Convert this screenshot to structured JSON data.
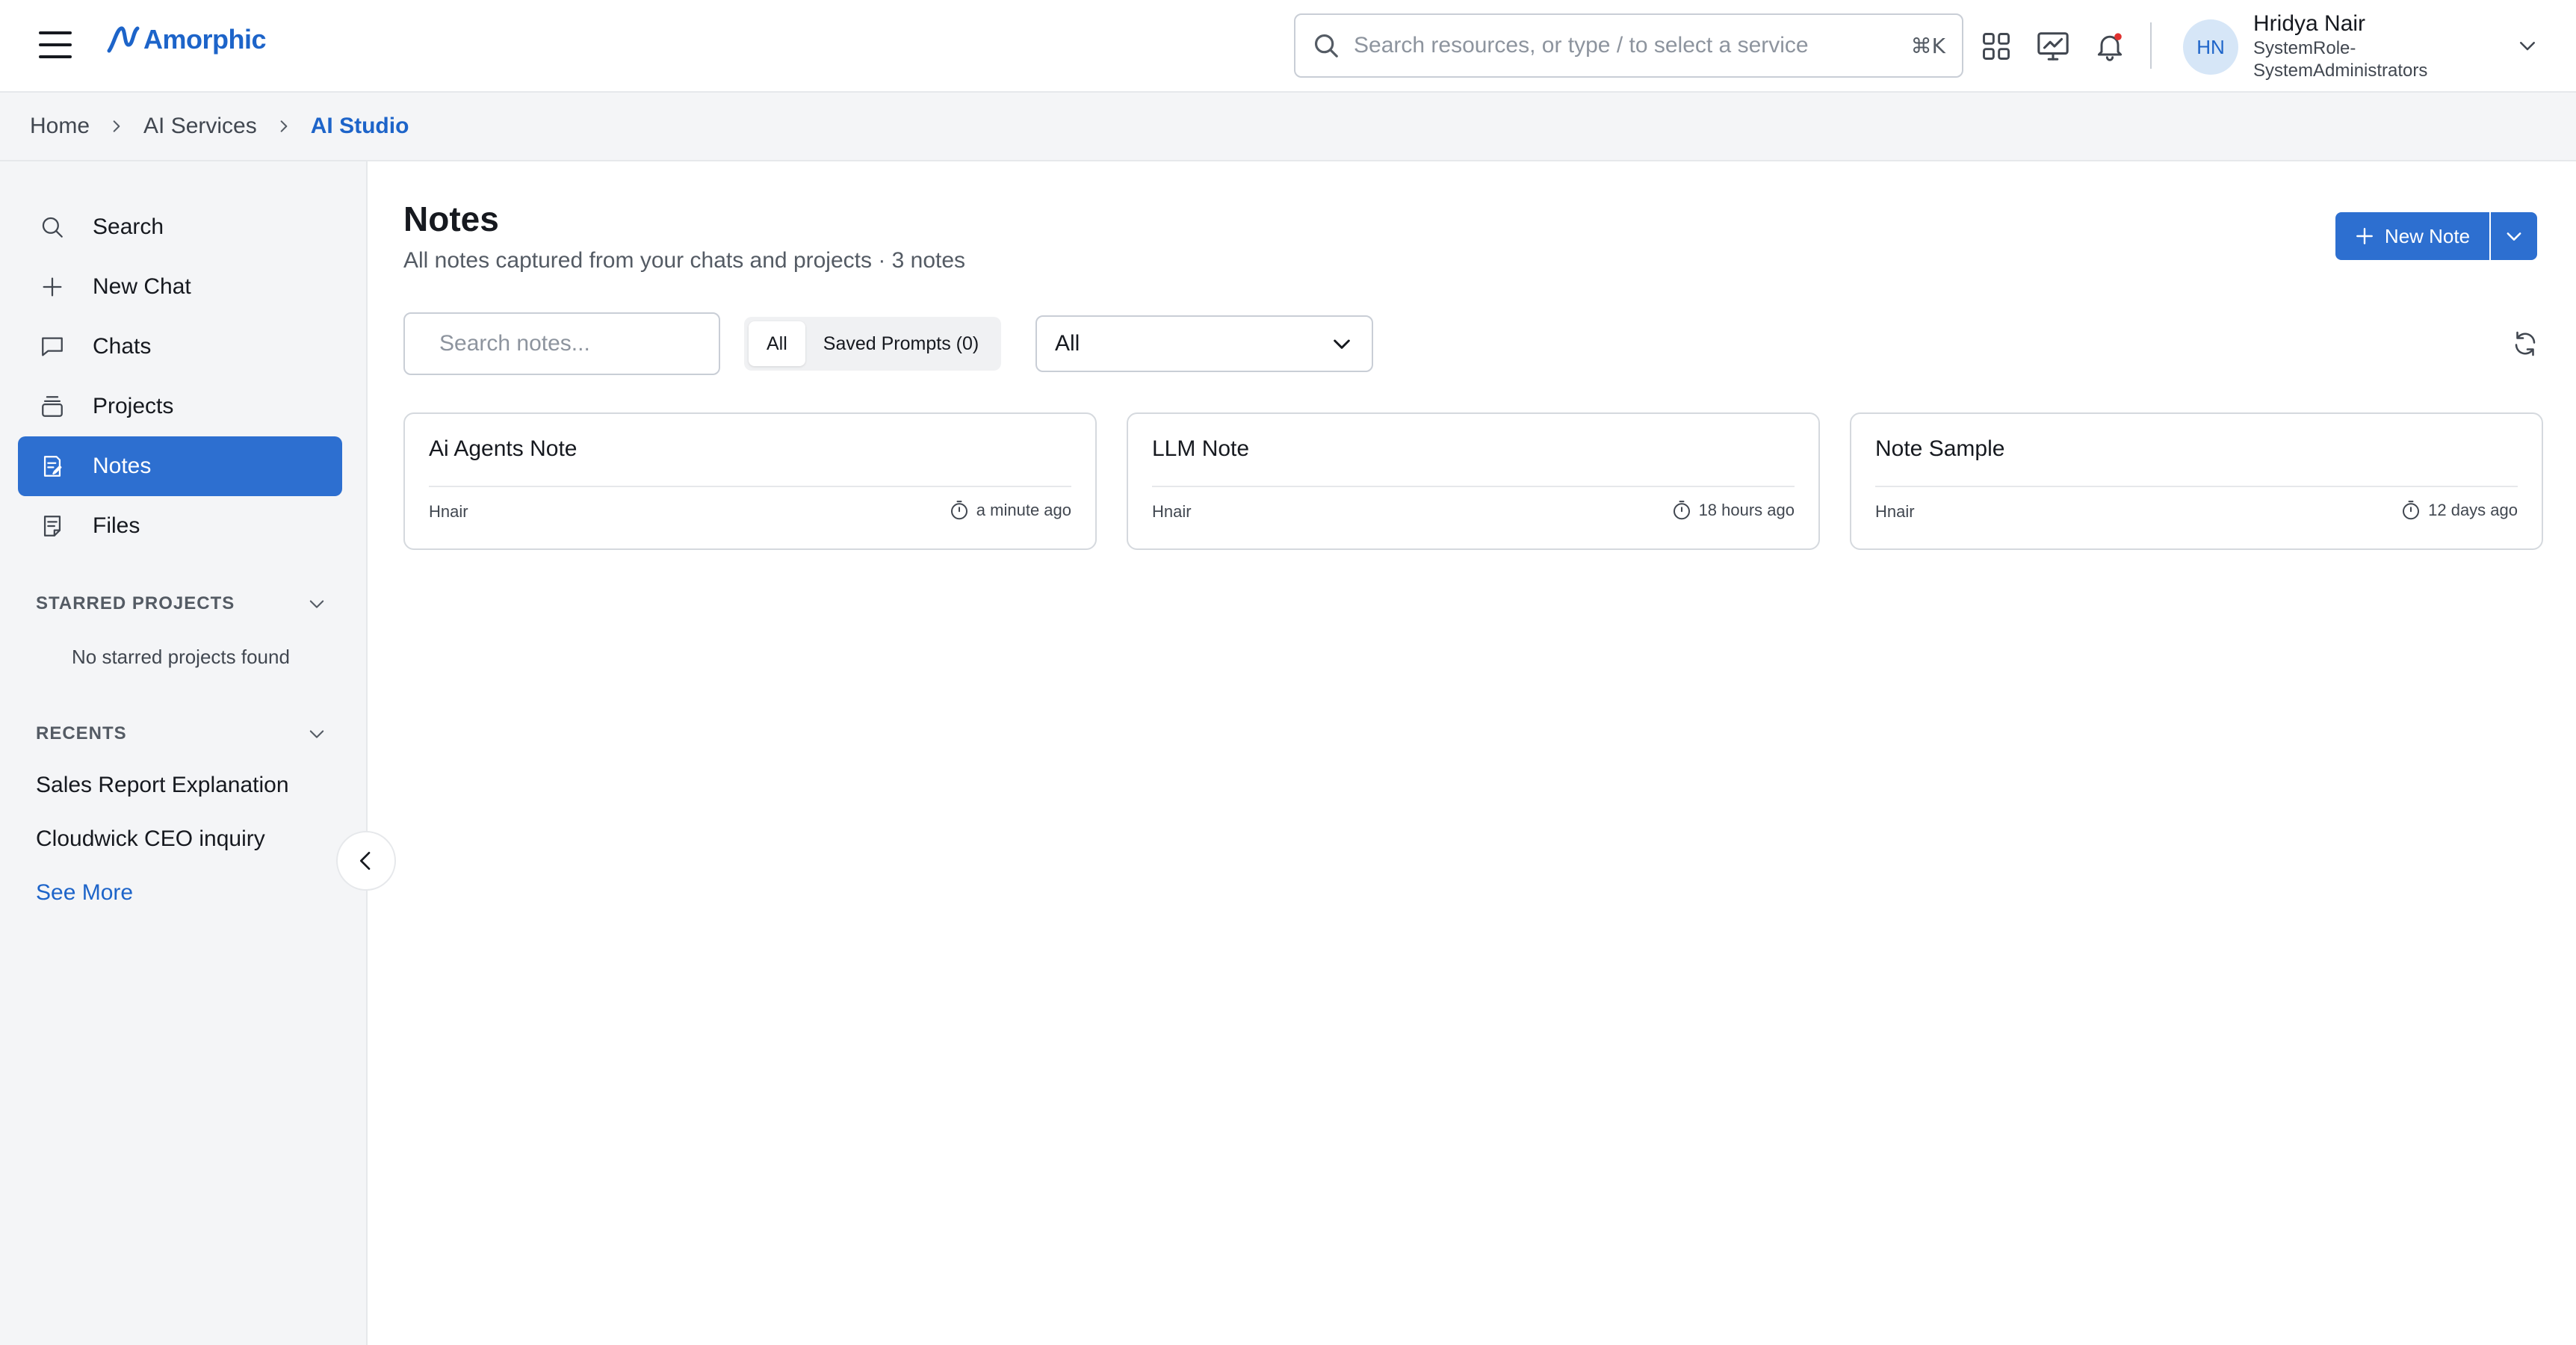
{
  "app": {
    "brand": "Amorphic",
    "brand_color": "#1d64c9",
    "accent": "#2d6fd0"
  },
  "header": {
    "search_placeholder": "Search resources, or type / to select a service",
    "shortcut": "⌘K",
    "icons": [
      "apps-grid-icon",
      "monitor-chart-icon",
      "bell-icon"
    ],
    "notification_dot_color": "#e0312f",
    "user": {
      "initials": "HN",
      "name": "Hridya Nair",
      "role_line1": "SystemRole-",
      "role_line2": "SystemAdministrators"
    }
  },
  "breadcrumb": [
    {
      "label": "Home"
    },
    {
      "label": "AI Services"
    },
    {
      "label": "AI Studio"
    }
  ],
  "sidebar": {
    "items": [
      {
        "label": "Search",
        "icon": "search-icon"
      },
      {
        "label": "New Chat",
        "icon": "plus-icon"
      },
      {
        "label": "Chats",
        "icon": "chat-bubble-icon"
      },
      {
        "label": "Projects",
        "icon": "projects-stack-icon"
      },
      {
        "label": "Notes",
        "icon": "notes-icon",
        "active": true
      },
      {
        "label": "Files",
        "icon": "files-icon"
      }
    ],
    "starred": {
      "title": "STARRED PROJECTS",
      "empty": "No starred projects found"
    },
    "recents": {
      "title": "RECENTS",
      "items": [
        "Sales Report Explanation",
        "Cloudwick CEO inquiry"
      ],
      "see_more": "See More"
    }
  },
  "main": {
    "title": "Notes",
    "subtitle": "All notes captured from your chats and projects · 3 notes",
    "new_note_label": "New Note",
    "search_placeholder": "Search notes...",
    "segments": [
      {
        "label": "All",
        "active": true
      },
      {
        "label": "Saved Prompts (0)"
      }
    ],
    "filter_value": "All",
    "cards": [
      {
        "title": "Ai Agents Note",
        "author": "Hnair",
        "time": "a minute ago"
      },
      {
        "title": "LLM Note",
        "author": "Hnair",
        "time": "18 hours ago"
      },
      {
        "title": "Note Sample",
        "author": "Hnair",
        "time": "12 days ago"
      }
    ]
  }
}
